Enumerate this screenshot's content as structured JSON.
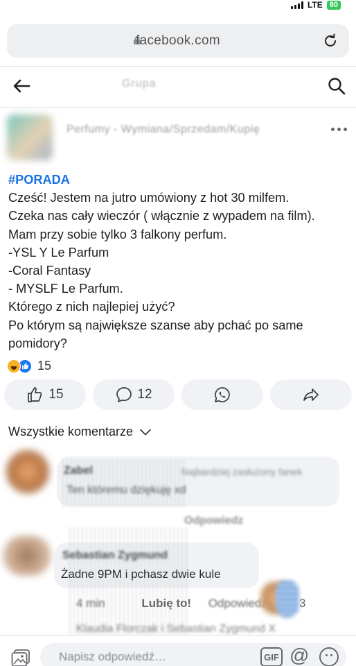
{
  "browser": {
    "url": "facebook.com",
    "network": "LTE",
    "battery": "80"
  },
  "header": {
    "title_blurred": "Grupa"
  },
  "post": {
    "group_name": "Perfumy - Wymiana/Sprzedam/Kupię",
    "hashtag": "#PORADA",
    "lines": [
      "Cześć! Jestem na jutro umówiony z hot 30 milfem.",
      "Czeka nas cały wieczór ( włącznie z wypadem na film).",
      "Mam przy sobie tylko 3 falkony perfum.",
      "-YSL Y Le Parfum",
      "-Coral Fantasy",
      "- MYSLF Le Parfum.",
      "Którego z nich najlepiej użyć?",
      "Po którym są największe szanse aby pchać po same",
      "pomidory?"
    ],
    "reaction_count": "15",
    "like_count": "15",
    "comment_count": "12"
  },
  "comments": {
    "filter_label": "Wszystkie komentarze",
    "first": {
      "author_blurred": "Zabel",
      "meta_blurred": "Najbardziej zasłużony fanek",
      "text_blurred": "Ten któremu dziękuję xd",
      "reply_blurred": "Odpowiedz"
    },
    "second": {
      "author_blurred": "Sebastian Zygmund",
      "text_visible": "Żadne 9PM i pchasz dwie kule",
      "time": "4 min",
      "like_label": "Lubię to!",
      "reply_label": "Odpowiedz",
      "count": "3",
      "replies_blurred": "Klaudia Florczak i Sebastian Zygmund X"
    }
  },
  "composer": {
    "placeholder": "Napisz odpowiedź…",
    "gif_label": "GIF",
    "at_label": "@"
  }
}
